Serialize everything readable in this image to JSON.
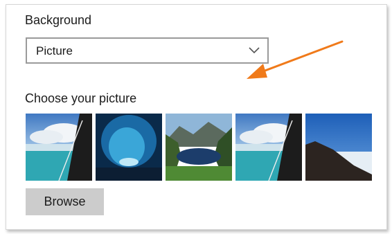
{
  "background_section": {
    "label": "Background",
    "dropdown": {
      "selected": "Picture",
      "icon": "chevron-down-icon"
    }
  },
  "picture_section": {
    "label": "Choose your picture",
    "thumbnails": [
      {
        "name": "lake-rocks-sky"
      },
      {
        "name": "ice-cave"
      },
      {
        "name": "mountain-lake"
      },
      {
        "name": "lake-rocks-sky"
      },
      {
        "name": "cliff-above-clouds"
      }
    ],
    "browse_label": "Browse"
  },
  "annotation": {
    "arrow_color": "#f07a1a"
  }
}
